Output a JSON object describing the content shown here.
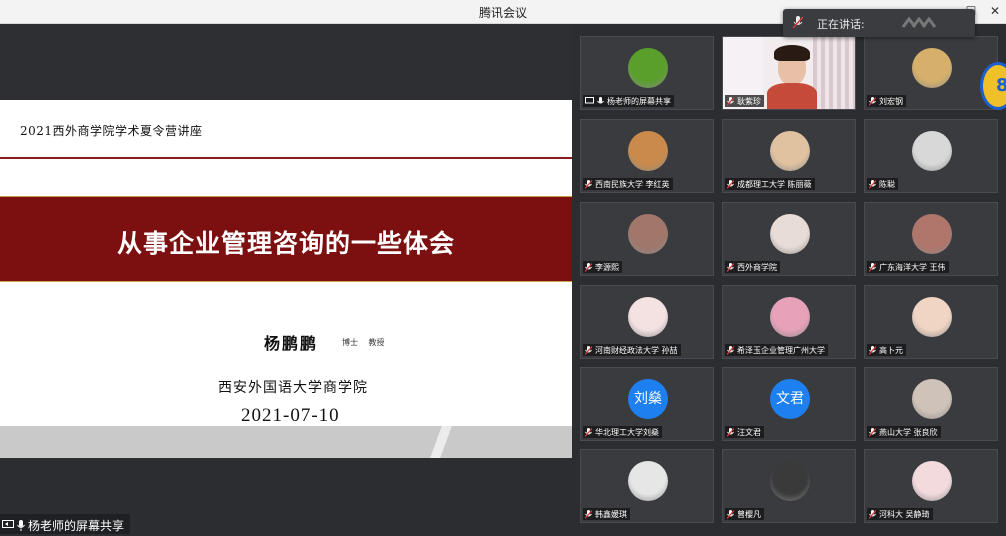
{
  "window": {
    "title": "腾讯会议",
    "controls": [
      "minimize-icon",
      "maximize-icon",
      "close-icon"
    ]
  },
  "speaking_popup": {
    "label": "正在讲话:"
  },
  "shared_screen": {
    "share_label": "杨老师的屏幕共享",
    "slide": {
      "header": "2021西外商学院学术夏令营讲座",
      "title": "从事企业管理咨询的一些体会",
      "author": "杨鹏鹏",
      "author_titles": "博士 教授",
      "school": "西安外国语大学商学院",
      "date": "2021-07-10"
    }
  },
  "participants": [
    {
      "name": "杨老师的屏幕共享",
      "screen_share": true,
      "mic": "on",
      "avatar": {
        "kind": "image",
        "color": "#5a9e2c"
      }
    },
    {
      "name": "耿紫珍",
      "mic": "muted",
      "avatar": {
        "kind": "video"
      }
    },
    {
      "name": "刘宏钢",
      "mic": "muted",
      "avatar": {
        "kind": "image",
        "color": "#d6b06a"
      }
    },
    {
      "name": "西南民族大学 李红英",
      "mic": "muted",
      "avatar": {
        "kind": "image",
        "color": "#c98a4b"
      }
    },
    {
      "name": "成都理工大学 陈丽薇",
      "mic": "muted",
      "avatar": {
        "kind": "image",
        "color": "#e0c2a0"
      }
    },
    {
      "name": "陈聪",
      "mic": "muted",
      "avatar": {
        "kind": "image",
        "color": "#d8d8d8"
      }
    },
    {
      "name": "李源熙",
      "mic": "muted",
      "avatar": {
        "kind": "image",
        "color": "#a0776a"
      }
    },
    {
      "name": "西外商学院",
      "mic": "muted",
      "avatar": {
        "kind": "image",
        "color": "#e8dcd6"
      }
    },
    {
      "name": "广东海洋大学 王伟",
      "mic": "muted",
      "avatar": {
        "kind": "image",
        "color": "#b0756b"
      }
    },
    {
      "name": "河南财经政法大学 孙喆",
      "mic": "muted",
      "avatar": {
        "kind": "image",
        "color": "#f4e2e2"
      }
    },
    {
      "name": "希泽玉企业管理广州大学",
      "mic": "muted",
      "avatar": {
        "kind": "image",
        "color": "#e7a1b8"
      }
    },
    {
      "name": "高卜元",
      "mic": "muted",
      "avatar": {
        "kind": "image",
        "color": "#f0d4c4"
      }
    },
    {
      "name": "华北理工大学刘燊",
      "mic": "muted",
      "avatar": {
        "kind": "text",
        "text": "刘燊",
        "color": "#1e80f0"
      }
    },
    {
      "name": "汪文君",
      "mic": "muted",
      "avatar": {
        "kind": "text",
        "text": "文君",
        "color": "#1e80f0"
      }
    },
    {
      "name": "燕山大学 张良欣",
      "mic": "muted",
      "avatar": {
        "kind": "image",
        "color": "#cfc2b8"
      }
    },
    {
      "name": "韩鑫媛琪",
      "mic": "muted",
      "avatar": {
        "kind": "image",
        "color": "#e6e6e6"
      }
    },
    {
      "name": "曾樱凡",
      "mic": "muted",
      "avatar": {
        "kind": "image",
        "color": "#3a3a3a"
      }
    },
    {
      "name": "河科大 吴静琦",
      "mic": "muted",
      "avatar": {
        "kind": "image",
        "color": "#f3dadd"
      }
    }
  ],
  "badge": {
    "text": "8"
  },
  "colors": {
    "slide_band": "#7c1010",
    "muted_mic": "#d23c3c",
    "text_avatar": "#1e80f0",
    "badge_ring": "#1c5fd0",
    "badge_fill": "#f0c028"
  }
}
